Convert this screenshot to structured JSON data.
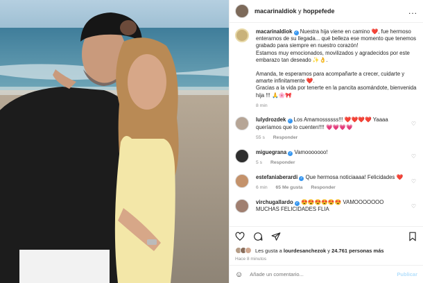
{
  "header": {
    "user1": "macarinaldiok",
    "conj": "y",
    "user2": "hoppefede",
    "more": "..."
  },
  "caption": {
    "user": "macarinaldiok",
    "line1": "Nuestra hija viene en camino ❤️, fue hermoso enterarnos de su llegada... qué belleza ese momento que tenemos grabado para siempre en nuestro corazón!",
    "line2": "Estamos muy emocionados, movilizados y agradecidos por este embarazo tan deseado ✨👌.",
    "line3": "Amanda, te esperamos para acompañarte a crecer, cuidarte y amarte infinitamente ❤️.",
    "line4": "Gracias a la vida por tenerte en la pancita asomándote, bienvenida hija !!! 🙏🌸🎀",
    "time": "8 min"
  },
  "comments": [
    {
      "user": "lulydrozdek",
      "text": "Los Amamossssss!!! ❤️❤️❤️❤️ Yaaaa queríamos que lo cuenten!!!! 💗💗💗💗",
      "time": "55 s",
      "reply": "Responder",
      "likes": ""
    },
    {
      "user": "miguegrana",
      "text": "Vamooooooo!",
      "time": "5 s",
      "reply": "Responder",
      "likes": ""
    },
    {
      "user": "estefaniaberardi",
      "text": "Que hermosa noticiaaaa! Felicidades ❤️",
      "time": "6 min",
      "reply": "Responder",
      "likes": "65 Me gusta"
    },
    {
      "user": "virchugallardo",
      "text": "😍😍😍😍😍😍 VAMOOOOOOO MUCHAS FELICIDADES FLIA",
      "time": "",
      "reply": "",
      "likes": ""
    }
  ],
  "likes": {
    "prefix": "Les gusta a",
    "user": "lourdesanchezok",
    "mid": "y",
    "count": "24.761 personas más"
  },
  "ago": "Hace 8 minutos",
  "add_comment": {
    "placeholder": "Añade un comentario...",
    "publish": "Publicar"
  },
  "icons": {
    "like": "heart-icon",
    "comment": "comment-icon",
    "share": "share-icon",
    "save": "bookmark-icon",
    "emoji": "emoji-icon",
    "more": "more-icon"
  },
  "colors": {
    "verified": "#3897f0",
    "heart_red": "#ed4956",
    "publish": "#b2dffc",
    "muted": "#8e8e8e"
  }
}
